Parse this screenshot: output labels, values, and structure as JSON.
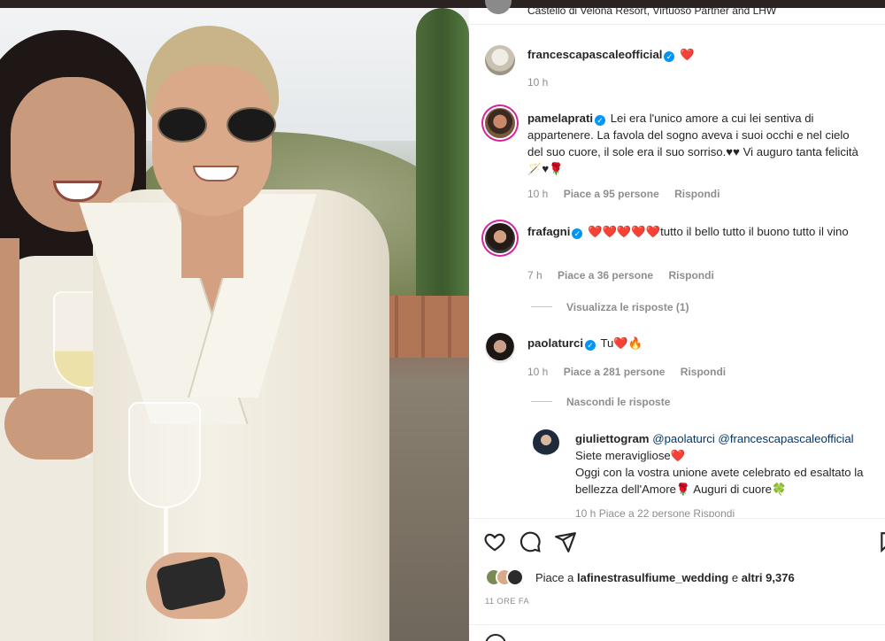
{
  "post": {
    "location": "Castello di Velona Resort, Virtuoso Partner and LHW",
    "likes_prefix": "Piace a",
    "likes_user": "lafinestrasulfiume_wedding",
    "likes_and": "e",
    "likes_others": "altri 9,376",
    "time_ago": "11 ORE FA"
  },
  "comments": [
    {
      "username": "francescapascaleofficial",
      "text": "❤️",
      "time": "10 h"
    },
    {
      "username": "pamelaprati",
      "text": "Lei era l'unico amore a cui lei sentiva di appartenere. La favola del sogno aveva i suoi occhi e nel cielo del suo cuore, il sole era il suo sorriso.♥♥ Vi auguro tanta felicità 🪄♥🌹",
      "time": "10 h",
      "likes": "Piace a 95 persone",
      "reply": "Rispondi"
    },
    {
      "username": "frafagni",
      "text": "❤️❤️❤️❤️❤️tutto il bello tutto il buono tutto il vino",
      "time": "7 h",
      "likes": "Piace a 36 persone",
      "reply": "Rispondi",
      "view_replies": "Visualizza le risposte (1)"
    },
    {
      "username": "paolaturci",
      "text": "Tu❤️🔥",
      "time": "10 h",
      "likes": "Piace a 281 persone",
      "reply": "Rispondi",
      "hide_replies": "Nascondi le risposte"
    }
  ],
  "reply": {
    "username": "giuliettogram",
    "mentions": "@paolaturci @francescapascaleofficial",
    "line1": "Siete meravigliose❤️",
    "line2": "Oggi con la vostra unione avete celebrato ed esaltato la bellezza dell'Amore🌹 Auguri di cuore🍀",
    "meta": "10 h   Piace a 22 persone   Rispondi"
  },
  "icons": [
    "heart-icon",
    "comment-icon",
    "share-icon",
    "bookmark-icon",
    "emoji-icon"
  ],
  "colors": {
    "verified": "#0095f6",
    "text": "#262626",
    "muted": "#8e8e8e",
    "heart": "#ed1c24"
  }
}
